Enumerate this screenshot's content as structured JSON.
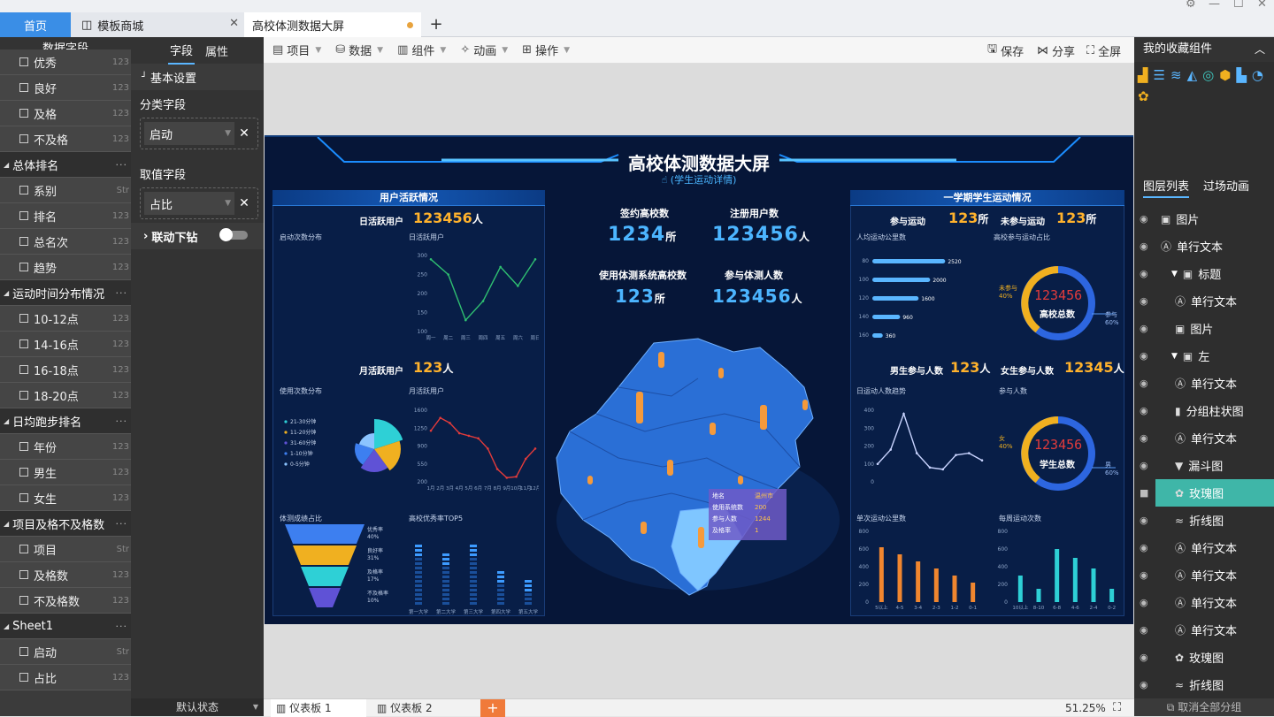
{
  "tabs": {
    "home": "首页",
    "store": "模板商城",
    "screen": "高校体测数据大屏",
    "add": "+"
  },
  "window": {
    "gear": "⚙",
    "minimize": "—",
    "maximize": "☐",
    "close": "✕"
  },
  "fields_panel": {
    "title": "数据字段",
    "rows": [
      {
        "type": "item",
        "label": "优秀",
        "dtype": "123"
      },
      {
        "type": "item",
        "label": "良好",
        "dtype": "123"
      },
      {
        "type": "item",
        "label": "及格",
        "dtype": "123"
      },
      {
        "type": "item",
        "label": "不及格",
        "dtype": "123"
      },
      {
        "type": "group",
        "label": "总体排名"
      },
      {
        "type": "item",
        "label": "系别",
        "dtype": "Str"
      },
      {
        "type": "item",
        "label": "排名",
        "dtype": "123"
      },
      {
        "type": "item",
        "label": "总名次",
        "dtype": "123"
      },
      {
        "type": "item",
        "label": "趋势",
        "dtype": "123"
      },
      {
        "type": "group",
        "label": "运动时间分布情况"
      },
      {
        "type": "item",
        "label": "10-12点",
        "dtype": "123"
      },
      {
        "type": "item",
        "label": "14-16点",
        "dtype": "123"
      },
      {
        "type": "item",
        "label": "16-18点",
        "dtype": "123"
      },
      {
        "type": "item",
        "label": "18-20点",
        "dtype": "123"
      },
      {
        "type": "group",
        "label": "日均跑步排名"
      },
      {
        "type": "item",
        "label": "年份",
        "dtype": "123"
      },
      {
        "type": "item",
        "label": "男生",
        "dtype": "123"
      },
      {
        "type": "item",
        "label": "女生",
        "dtype": "123"
      },
      {
        "type": "group",
        "label": "项目及格不及格数"
      },
      {
        "type": "item",
        "label": "项目",
        "dtype": "Str"
      },
      {
        "type": "item",
        "label": "及格数",
        "dtype": "123"
      },
      {
        "type": "item",
        "label": "不及格数",
        "dtype": "123"
      },
      {
        "type": "group",
        "label": "Sheet1"
      },
      {
        "type": "item",
        "label": "启动",
        "dtype": "Str"
      },
      {
        "type": "item",
        "label": "占比",
        "dtype": "123"
      }
    ]
  },
  "prop_panel": {
    "tab_field": "字段",
    "tab_attr": "属性",
    "basic": "基本设置",
    "category_label": "分类字段",
    "category_value": "启动",
    "value_label": "取值字段",
    "value_value": "占比",
    "drill": "联动下钻",
    "default_state": "默认状态"
  },
  "toolbar": {
    "project": "项目",
    "data": "数据",
    "component": "组件",
    "animation": "动画",
    "operation": "操作",
    "save": "保存",
    "share": "分享",
    "fullscreen": "全屏"
  },
  "screen": {
    "title": "高校体测数据大屏",
    "subtitle": "(学生运动详情)",
    "left_header": "用户活跃情况",
    "dau_label": "日活跃用户",
    "dau_value": "123456",
    "unit_person": "人",
    "mau_label": "月活跃用户",
    "mau_value": "123",
    "start_dist": "启动次数分布",
    "dau_chart": "日活跃用户",
    "use_dist": "使用次数分布",
    "mau_chart": "月活跃用户",
    "pass_rate": "体测成绩占比",
    "excellent": "高校优秀率TOP5",
    "center": {
      "signed_label": "签约高校数",
      "signed_value": "1234",
      "unit_school": "所",
      "reg_label": "注册用户数",
      "reg_value": "123456",
      "using_label": "使用体测系统高校数",
      "using_value": "123",
      "test_label": "参与体测人数",
      "test_value": "123456"
    },
    "tooltip": {
      "rows": [
        [
          "地名",
          "温州市"
        ],
        [
          "使用系统数",
          "200"
        ],
        [
          "参与人数",
          "1244"
        ],
        [
          "及格率",
          "1"
        ]
      ]
    },
    "right_header": "一学期学生运动情况",
    "join_label": "参与运动",
    "join_value": "123",
    "nojoin_label": "未参与运动",
    "nojoin_value": "123",
    "avg_km": "人均运动公里数",
    "school_ratio": "高校参与运动占比",
    "male_label": "男生参与人数",
    "male_value": "123",
    "female_label": "女生参与人数",
    "female_value": "12345",
    "trend": "日运动人数趋势",
    "participants": "参与人数",
    "single_km": "单次运动公里数",
    "weekly": "每周运动次数",
    "donut1_num": "123456",
    "donut1_label": "高校总数",
    "donut2_num": "123456",
    "donut2_label": "学生总数",
    "donut1_left": "未参与",
    "donut1_left_pct": "40%",
    "donut1_right": "参与",
    "donut1_right_pct": "60%",
    "donut2_left": "女",
    "donut2_left_pct": "40%",
    "donut2_right": "男",
    "donut2_right_pct": "60%",
    "funnel": [
      [
        "优秀率",
        "40%"
      ],
      [
        "良好率",
        "31%"
      ],
      [
        "及格率",
        "17%"
      ],
      [
        "不及格率",
        "10%"
      ]
    ],
    "pie_legend": [
      "21-30分钟",
      "11-20分钟",
      "31-60分钟",
      "1-10分钟",
      "0-5分钟"
    ]
  },
  "chart_data": [
    {
      "type": "line",
      "title": "日活跃用户",
      "categories": [
        "周一",
        "周二",
        "周三",
        "周四",
        "周五",
        "周六",
        "周日"
      ],
      "values": [
        290,
        250,
        130,
        180,
        270,
        220,
        290
      ],
      "ylim": [
        100,
        300
      ]
    },
    {
      "type": "line",
      "title": "月活跃用户",
      "categories": [
        "1月",
        "2月",
        "3月",
        "4月",
        "5月",
        "6月",
        "7月",
        "8月",
        "9月",
        "10月",
        "11月",
        "12月"
      ],
      "values": [
        1200,
        1450,
        1350,
        1150,
        1100,
        1050,
        850,
        450,
        280,
        300,
        650,
        850
      ],
      "ylim": [
        200,
        1600
      ]
    },
    {
      "type": "bar",
      "title": "人均运动公里数",
      "categories": [
        "80",
        "100",
        "120",
        "140",
        "160"
      ],
      "values": [
        2520,
        2000,
        1600,
        960,
        360
      ],
      "xlim": [
        0,
        3000
      ]
    },
    {
      "type": "bar",
      "title": "单次运动公里数",
      "categories": [
        "5以上",
        "4-5",
        "3-4",
        "2-3",
        "1-2",
        "0-1"
      ],
      "values": [
        620,
        540,
        460,
        380,
        300,
        220
      ],
      "ylim": [
        0,
        800
      ]
    },
    {
      "type": "bar",
      "title": "每周运动次数",
      "categories": [
        "10以上",
        "8-10",
        "6-8",
        "4-6",
        "2-4",
        "0-2"
      ],
      "values": [
        300,
        150,
        600,
        500,
        380,
        150
      ],
      "ylim": [
        0,
        800
      ]
    },
    {
      "type": "line",
      "title": "日运动人数趋势",
      "values": [
        100,
        180,
        380,
        160,
        80,
        70,
        150,
        160,
        120
      ],
      "ylim": [
        0,
        400
      ]
    }
  ],
  "right_panel": {
    "fav_title": "我的收藏组件",
    "tab_layers": "图层列表",
    "tab_anim": "过场动画",
    "layers": [
      {
        "label": "图片",
        "icon": "▣",
        "indent": 0
      },
      {
        "label": "单行文本",
        "icon": "Ⓐ",
        "indent": 0
      },
      {
        "label": "标题",
        "icon": "▣",
        "indent": 1,
        "group": true
      },
      {
        "label": "单行文本",
        "icon": "Ⓐ",
        "indent": 2
      },
      {
        "label": "图片",
        "icon": "▣",
        "indent": 2
      },
      {
        "label": "左",
        "icon": "▣",
        "indent": 1,
        "group": true
      },
      {
        "label": "单行文本",
        "icon": "Ⓐ",
        "indent": 2
      },
      {
        "label": "分组柱状图",
        "icon": "▮",
        "indent": 2
      },
      {
        "label": "单行文本",
        "icon": "Ⓐ",
        "indent": 2
      },
      {
        "label": "漏斗图",
        "icon": "▼",
        "indent": 2
      },
      {
        "label": "玫瑰图",
        "icon": "✿",
        "indent": 2,
        "selected": true
      },
      {
        "label": "折线图",
        "icon": "≈",
        "indent": 2
      },
      {
        "label": "单行文本",
        "icon": "Ⓐ",
        "indent": 2
      },
      {
        "label": "单行文本",
        "icon": "Ⓐ",
        "indent": 2
      },
      {
        "label": "单行文本",
        "icon": "Ⓐ",
        "indent": 2
      },
      {
        "label": "单行文本",
        "icon": "Ⓐ",
        "indent": 2
      },
      {
        "label": "玫瑰图",
        "icon": "✿",
        "indent": 2
      },
      {
        "label": "折线图",
        "icon": "≈",
        "indent": 2
      }
    ],
    "cancel_group": "取消全部分组"
  },
  "bottom": {
    "board1": "仪表板 1",
    "board2": "仪表板 2",
    "zoom": "51.25%"
  }
}
